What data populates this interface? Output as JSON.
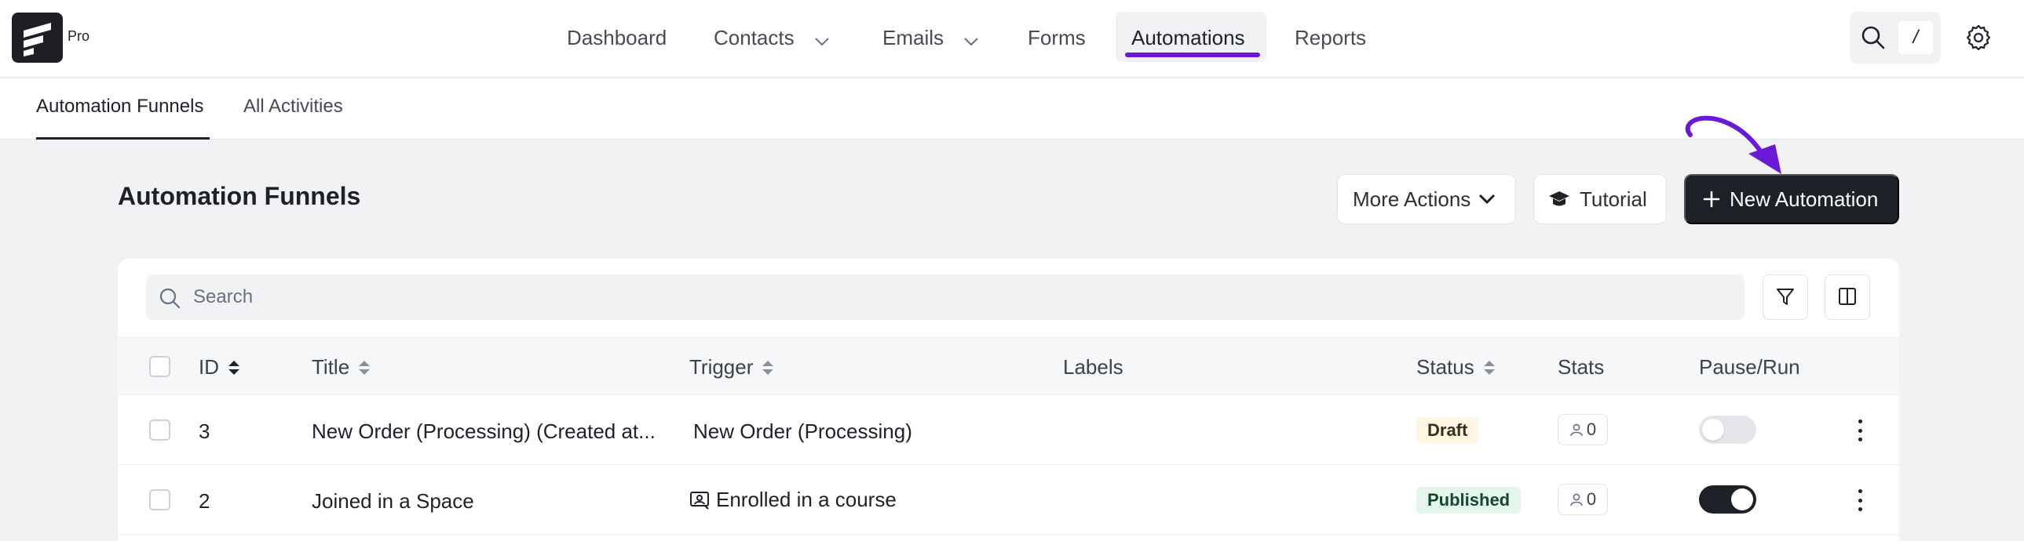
{
  "brand": {
    "badge": "Pro"
  },
  "nav": {
    "items": [
      {
        "label": "Dashboard"
      },
      {
        "label": "Contacts"
      },
      {
        "label": "Emails"
      },
      {
        "label": "Forms"
      },
      {
        "label": "Automations"
      },
      {
        "label": "Reports"
      }
    ],
    "active": "Automations",
    "search_shortcut": "/",
    "accent": "#6a19d8"
  },
  "subtabs": [
    {
      "label": "Automation Funnels"
    },
    {
      "label": "All Activities"
    }
  ],
  "page": {
    "title": "Automation Funnels",
    "more_actions_label": "More Actions",
    "tutorial_label": "Tutorial",
    "new_automation_label": "New Automation"
  },
  "table": {
    "search_placeholder": "Search",
    "columns": [
      "ID",
      "Title",
      "Trigger",
      "Labels",
      "Status",
      "Stats",
      "Pause/Run"
    ],
    "rows": [
      {
        "id": "3",
        "title": "New Order (Processing) (Created at...",
        "trigger": "New Order (Processing)",
        "status": "Draft",
        "stats": "0",
        "running": false
      },
      {
        "id": "2",
        "title": "Joined in a Space",
        "trigger": "Enrolled in a course",
        "status": "Published",
        "stats": "0",
        "running": true
      }
    ]
  },
  "icons": {
    "search": "search-icon",
    "settings": "gear-icon",
    "tutorial": "graduation-cap-icon",
    "new": "plus-icon",
    "filter": "filter-icon",
    "columns": "columns-icon",
    "stats": "user-icon",
    "trigger_course": "course-icon"
  }
}
